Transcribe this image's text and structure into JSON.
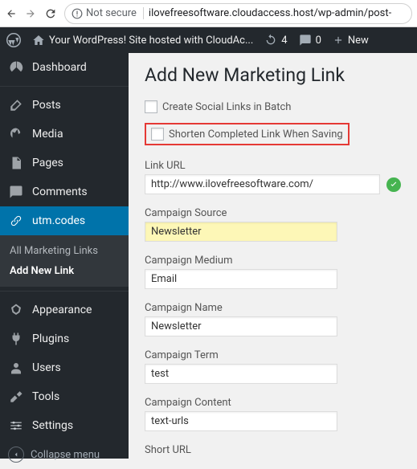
{
  "browser": {
    "not_secure": "Not secure",
    "url": "ilovefreesoftware.cloudaccess.host/wp-admin/post-"
  },
  "adminbar": {
    "site_name": "Your WordPress! Site hosted with CloudAc...",
    "updates": "4",
    "comments": "0",
    "new": "New"
  },
  "sidebar": {
    "dashboard": "Dashboard",
    "posts": "Posts",
    "media": "Media",
    "pages": "Pages",
    "comments": "Comments",
    "utmcodes": "utm.codes",
    "sub_links": "All Marketing Links",
    "sub_add": "Add New Link",
    "appearance": "Appearance",
    "plugins": "Plugins",
    "users": "Users",
    "tools": "Tools",
    "settings": "Settings",
    "collapse": "Collapse menu"
  },
  "page": {
    "title": "Add New Marketing Link",
    "cb_batch": "Create Social Links in Batch",
    "cb_shorten": "Shorten Completed Link When Saving",
    "link_url_label": "Link URL",
    "link_url_value": "http://www.ilovefreesoftware.com/",
    "source_label": "Campaign Source",
    "source_value": "Newsletter",
    "medium_label": "Campaign Medium",
    "medium_value": "Email",
    "name_label": "Campaign Name",
    "name_value": "Newsletter",
    "term_label": "Campaign Term",
    "term_value": "test",
    "content_label": "Campaign Content",
    "content_value": "text-urls",
    "short_label": "Short URL"
  }
}
